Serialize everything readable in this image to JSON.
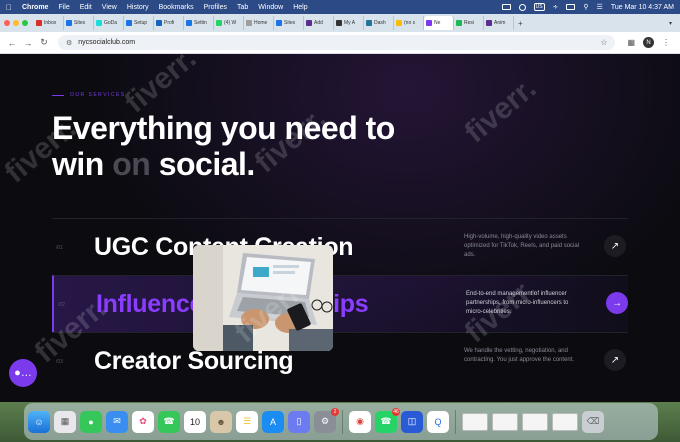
{
  "menubar": {
    "app": "Chrome",
    "items": [
      "File",
      "Edit",
      "View",
      "History",
      "Bookmarks",
      "Profiles",
      "Tab",
      "Window",
      "Help"
    ],
    "keyboard": "US",
    "clock": "Tue Mar 10  4:37 AM"
  },
  "tabs": [
    {
      "label": "Inbox",
      "color": "#d93025"
    },
    {
      "label": "Sites",
      "color": "#1a73e8"
    },
    {
      "label": "GoDa",
      "color": "#1bdbdb"
    },
    {
      "label": "Setup",
      "color": "#1a73e8"
    },
    {
      "label": "Profi",
      "color": "#1565c0"
    },
    {
      "label": "Settin",
      "color": "#1a73e8"
    },
    {
      "label": "(4) W",
      "color": "#25d366"
    },
    {
      "label": "Home",
      "color": "#9e9e9e"
    },
    {
      "label": "Sites",
      "color": "#1a73e8"
    },
    {
      "label": "Add",
      "color": "#5c2d91"
    },
    {
      "label": "My A",
      "color": "#333333"
    },
    {
      "label": "Dash",
      "color": "#21759b"
    },
    {
      "label": "(no s",
      "color": "#fbbc04"
    },
    {
      "label": "Ne",
      "color": "#7c3aed",
      "active": true
    },
    {
      "label": "Resi",
      "color": "#1db954"
    },
    {
      "label": "Anim",
      "color": "#5c2d91"
    }
  ],
  "address": {
    "url": "nycsocialclub.com"
  },
  "profile_initial": "N",
  "hero": {
    "eyebrow": "OUR SERVICES",
    "headline_line1": "Everything you need to",
    "headline_line2_a": "win ",
    "headline_line2_dim": "on",
    "headline_line2_b": " social."
  },
  "services": [
    {
      "num": "/01",
      "title": "UGC Content Creation",
      "desc": "High-volume, high-quality video assets optimized for TikTok, Reels, and paid social ads."
    },
    {
      "num": "/02",
      "title": "Influencer Partnerships",
      "desc": "End-to-end management of influencer partnerships, from micro-influencers to micro-celebrities."
    },
    {
      "num": "/03",
      "title": "Creator Sourcing",
      "desc": "We handle the vetting, negotiation, and contracting. You just approve the content."
    }
  ],
  "watermark_text": "fiverr.",
  "dock": {
    "calendar_day": "10",
    "badges": {
      "settings": "2",
      "whatsapp": "46"
    }
  },
  "colors": {
    "accent": "#7c3aed",
    "background": "#0b0b10"
  }
}
